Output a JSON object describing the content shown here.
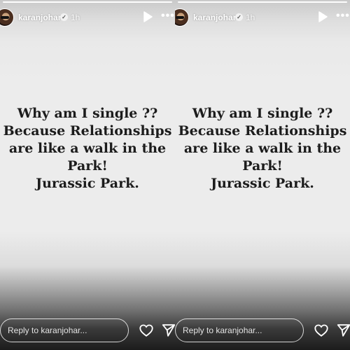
{
  "stories": [
    {
      "username": "karanjohar",
      "time": "1h",
      "text_lines": [
        "Why am I single ??",
        "Because Relationships",
        "are like a walk in the",
        "Park!",
        "Jurassic Park."
      ],
      "reply_placeholder": "Reply to karanjohar..."
    },
    {
      "username": "karanjohar",
      "time": "1h",
      "text_lines": [
        "Why am I single ??",
        "Because Relationships",
        "are like a walk in the",
        "Park!",
        "Jurassic Park."
      ],
      "reply_placeholder": "Reply to karanjohar..."
    }
  ],
  "icons": {
    "verified": "verified-badge-icon",
    "play": "play-icon",
    "more": "more-options-icon",
    "like": "heart-icon",
    "send": "send-icon"
  },
  "colors": {
    "text": "#1c1c1c",
    "background": "#ececec",
    "header_text": "#ffffff"
  }
}
